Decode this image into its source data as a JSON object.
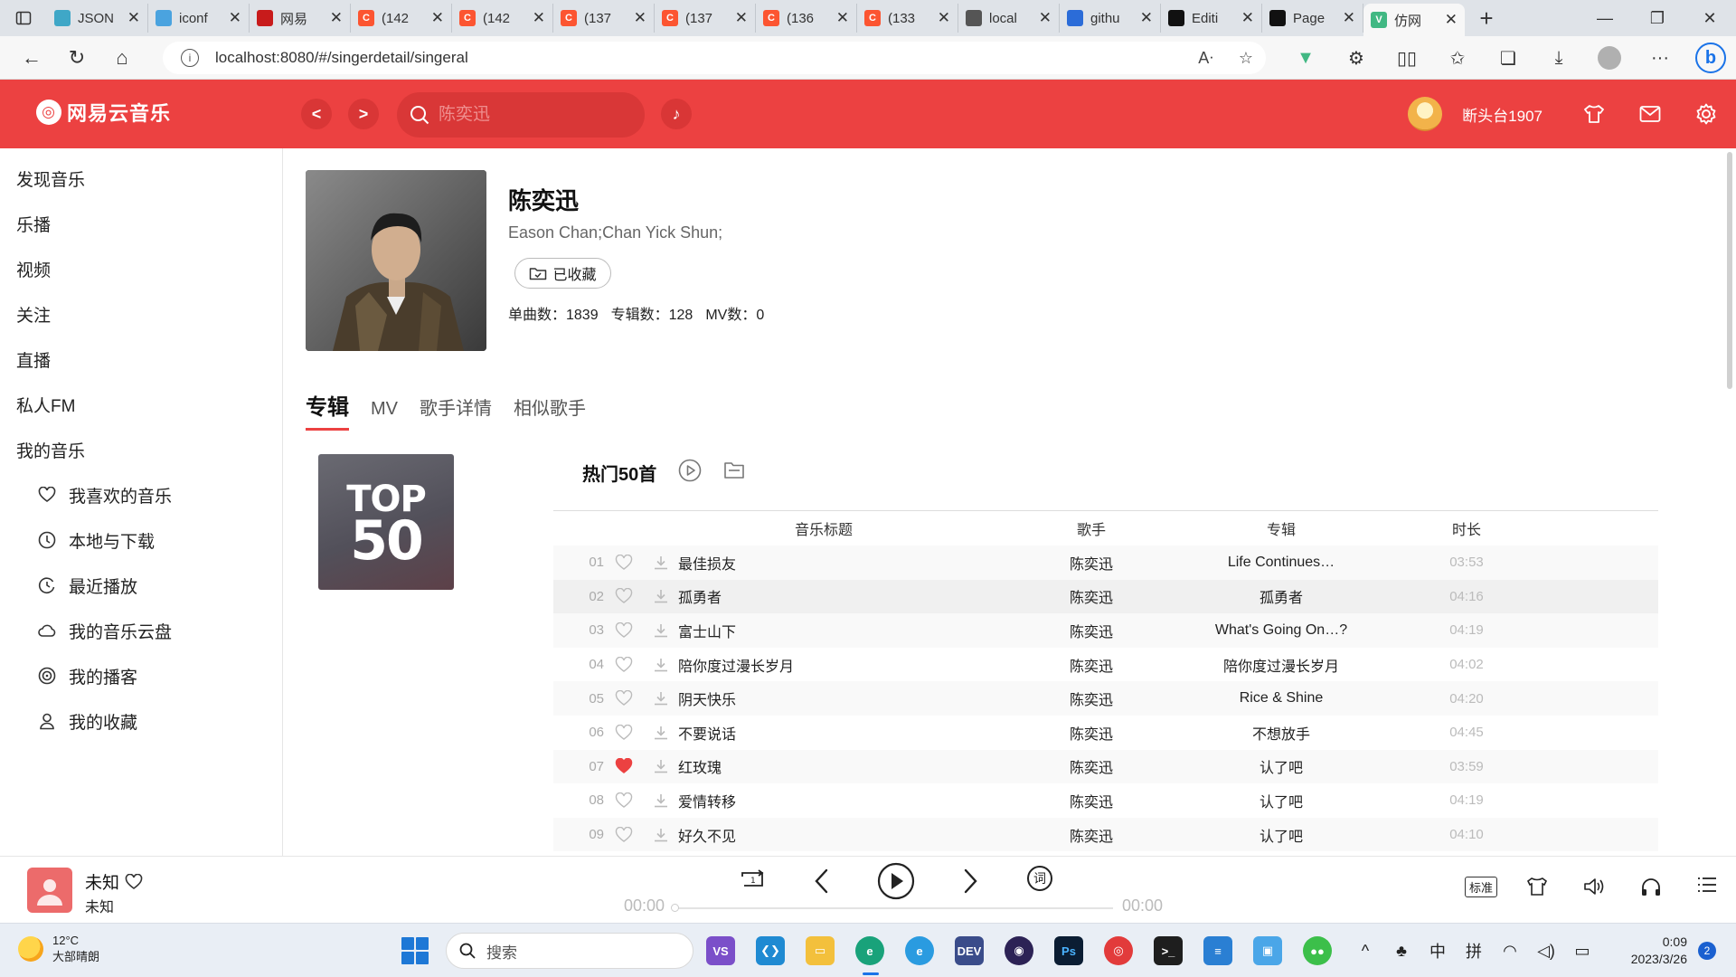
{
  "browser": {
    "tabs": [
      {
        "label": "JSON",
        "color": "#3fa7c7",
        "glyph": "",
        "active": false
      },
      {
        "label": "iconf",
        "color": "#4aa3df",
        "glyph": "",
        "active": false
      },
      {
        "label": "网易",
        "color": "#c81b1b",
        "glyph": "",
        "active": false
      },
      {
        "label": "(142",
        "color": "#fc5531",
        "glyph": "C",
        "active": false
      },
      {
        "label": "(142",
        "color": "#fc5531",
        "glyph": "C",
        "active": false
      },
      {
        "label": "(137",
        "color": "#fc5531",
        "glyph": "C",
        "active": false
      },
      {
        "label": "(137",
        "color": "#fc5531",
        "glyph": "C",
        "active": false
      },
      {
        "label": "(136",
        "color": "#fc5531",
        "glyph": "C",
        "active": false
      },
      {
        "label": "(133",
        "color": "#fc5531",
        "glyph": "C",
        "active": false
      },
      {
        "label": "local",
        "color": "#555555",
        "glyph": "",
        "active": false
      },
      {
        "label": "githu",
        "color": "#2b6cd8",
        "glyph": "",
        "active": false
      },
      {
        "label": "Editi",
        "color": "#111111",
        "glyph": "",
        "active": false
      },
      {
        "label": "Page",
        "color": "#111111",
        "glyph": "",
        "active": false
      },
      {
        "label": "仿网",
        "color": "#41b883",
        "glyph": "V",
        "active": true
      }
    ],
    "url": "localhost:8080/#/singerdetail/singeral"
  },
  "header": {
    "logo": "网易云音乐",
    "back_label": "<",
    "forward_label": ">",
    "search_placeholder": "陈奕迅",
    "username": "断头台1907"
  },
  "sidebar": {
    "items": [
      "发现音乐",
      "乐播",
      "视频",
      "关注",
      "直播",
      "私人FM",
      "我的音乐"
    ],
    "sub_items": [
      {
        "label": "我喜欢的音乐",
        "icon": "heart-icon"
      },
      {
        "label": "本地与下载",
        "icon": "download-circle-icon"
      },
      {
        "label": "最近播放",
        "icon": "history-icon"
      },
      {
        "label": "我的音乐云盘",
        "icon": "cloud-icon"
      },
      {
        "label": "我的播客",
        "icon": "podcast-icon"
      },
      {
        "label": "我的收藏",
        "icon": "person-icon"
      }
    ]
  },
  "singer": {
    "name": "陈奕迅",
    "alias": "Eason Chan;Chan Yick Shun;",
    "fav_label": "已收藏",
    "stats": [
      "单曲数：1839",
      "专辑数：128",
      "MV数：0"
    ]
  },
  "content_tabs": [
    "专辑",
    "MV",
    "歌手详情",
    "相似歌手"
  ],
  "album": {
    "cover_line1": "TOP",
    "cover_line2": "50",
    "title": "热门50首"
  },
  "table": {
    "headers": {
      "title": "音乐标题",
      "artist": "歌手",
      "album": "专辑",
      "duration": "时长"
    },
    "rows": [
      {
        "no": "01",
        "title": "最佳损友",
        "artist": "陈奕迅",
        "album": "Life Continues…",
        "duration": "03:53",
        "liked": false
      },
      {
        "no": "02",
        "title": "孤勇者",
        "artist": "陈奕迅",
        "album": "孤勇者",
        "duration": "04:16",
        "liked": false
      },
      {
        "no": "03",
        "title": "富士山下",
        "artist": "陈奕迅",
        "album": "What's Going On…?",
        "duration": "04:19",
        "liked": false
      },
      {
        "no": "04",
        "title": "陪你度过漫长岁月",
        "artist": "陈奕迅",
        "album": "陪你度过漫长岁月",
        "duration": "04:02",
        "liked": false
      },
      {
        "no": "05",
        "title": "阴天快乐",
        "artist": "陈奕迅",
        "album": "Rice & Shine",
        "duration": "04:20",
        "liked": false
      },
      {
        "no": "06",
        "title": "不要说话",
        "artist": "陈奕迅",
        "album": "不想放手",
        "duration": "04:45",
        "liked": false
      },
      {
        "no": "07",
        "title": "红玫瑰",
        "artist": "陈奕迅",
        "album": "认了吧",
        "duration": "03:59",
        "liked": true
      },
      {
        "no": "08",
        "title": "爱情转移",
        "artist": "陈奕迅",
        "album": "认了吧",
        "duration": "04:19",
        "liked": false
      },
      {
        "no": "09",
        "title": "好久不见",
        "artist": "陈奕迅",
        "album": "认了吧",
        "duration": "04:10",
        "liked": false
      }
    ]
  },
  "player": {
    "song": "未知",
    "artist": "未知",
    "current_time": "00:00",
    "total_time": "00:00",
    "lyrics_label": "词",
    "quality_label": "标准"
  },
  "taskbar": {
    "temperature": "12°C",
    "weather": "大部晴朗",
    "search_placeholder": "搜索",
    "ime1": "中",
    "ime2": "拼",
    "time": "0:09",
    "date": "2023/3/26",
    "notifications": "2"
  },
  "colors": {
    "brand_red": "#ec4141",
    "like_red": "#ec4141"
  }
}
